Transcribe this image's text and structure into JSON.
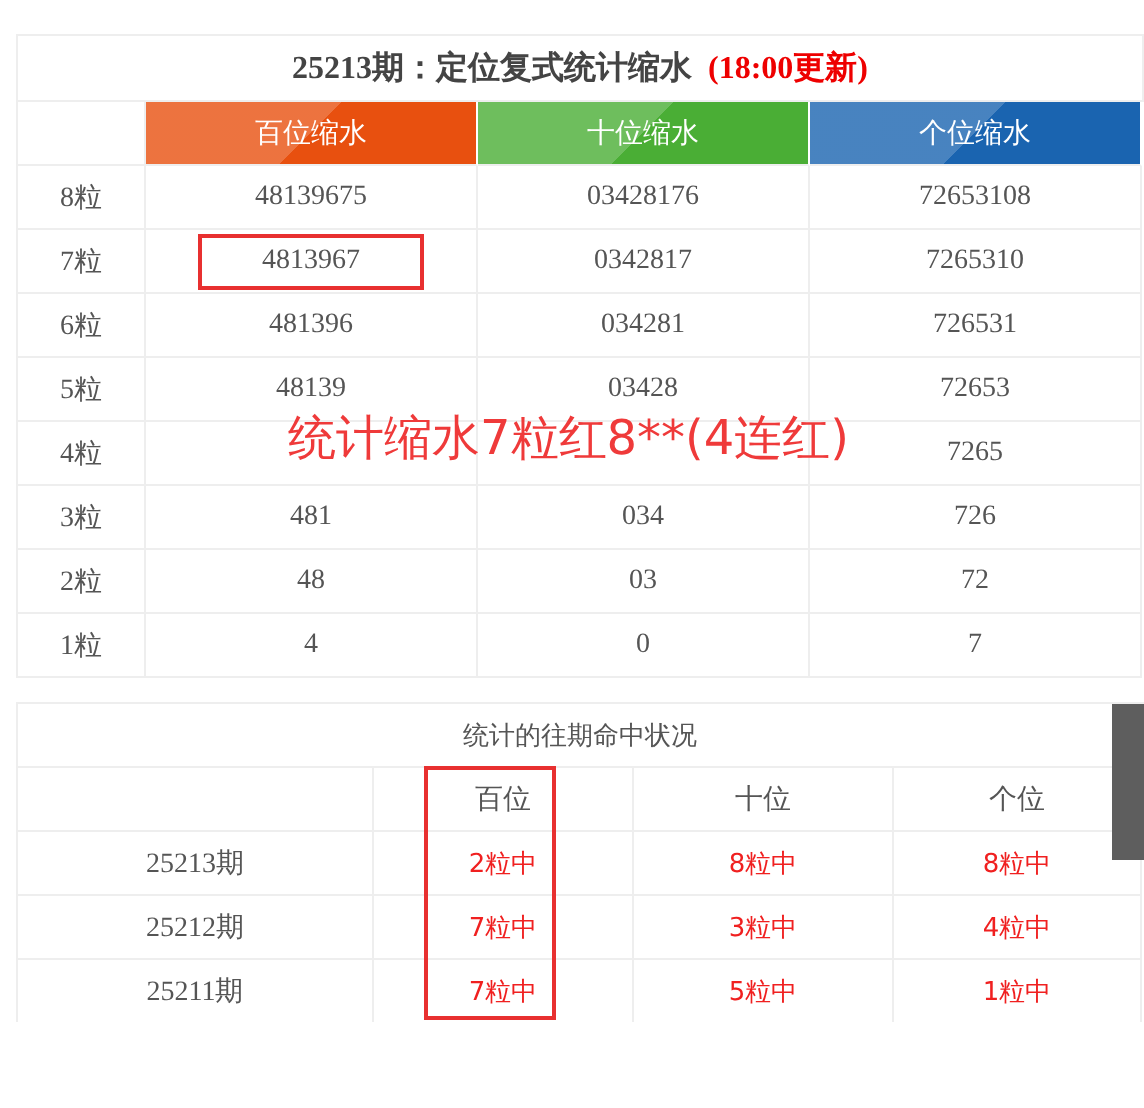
{
  "shrink_table": {
    "title": "25213期：定位复式统计缩水",
    "title_note": "(18:00更新)",
    "columns": [
      {
        "label": "百位缩水",
        "color": "#e8500f"
      },
      {
        "label": "十位缩水",
        "color": "#4aae35"
      },
      {
        "label": "个位缩水",
        "color": "#1a64b0"
      }
    ],
    "rows": [
      {
        "label": "8粒",
        "cells": [
          {
            "text": "48139675",
            "highlighted": false
          },
          {
            "text": "03428176",
            "highlighted": false
          },
          {
            "text": "72653108",
            "highlighted": false
          }
        ]
      },
      {
        "label": "7粒",
        "cells": [
          {
            "text": "4813967",
            "highlighted": true
          },
          {
            "text": "0342817",
            "highlighted": false
          },
          {
            "text": "7265310",
            "highlighted": false
          }
        ]
      },
      {
        "label": "6粒",
        "cells": [
          {
            "text": "481396",
            "highlighted": false
          },
          {
            "text": "034281",
            "highlighted": false
          },
          {
            "text": "726531",
            "highlighted": false
          }
        ]
      },
      {
        "label": "5粒",
        "cells": [
          {
            "text": "48139",
            "highlighted": false
          },
          {
            "text": "03428",
            "highlighted": false
          },
          {
            "text": "72653",
            "highlighted": false
          }
        ]
      },
      {
        "label": "4粒",
        "cells": [
          {
            "highlighted": false
          },
          {
            "highlighted": false
          },
          {
            "text": "7265",
            "highlighted": false
          }
        ]
      },
      {
        "label": "3粒",
        "cells": [
          {
            "text": "481",
            "highlighted": false
          },
          {
            "text": "034",
            "highlighted": false
          },
          {
            "text": "726",
            "highlighted": false
          }
        ]
      },
      {
        "label": "2粒",
        "cells": [
          {
            "text": "48",
            "highlighted": false
          },
          {
            "text": "03",
            "highlighted": false
          },
          {
            "text": "72",
            "highlighted": false
          }
        ]
      },
      {
        "label": "1粒",
        "cells": [
          {
            "text": "4",
            "highlighted": false
          },
          {
            "text": "0",
            "highlighted": false
          },
          {
            "text": "7",
            "highlighted": false
          }
        ]
      }
    ]
  },
  "annotation": "统计缩水7粒红8**(4连红)",
  "history_table": {
    "title": "统计的往期命中状况",
    "columns": [
      {
        "label": "百位",
        "highlighted": true
      },
      {
        "label": "十位",
        "highlighted": false
      },
      {
        "label": "个位",
        "highlighted": false
      }
    ],
    "rows": [
      {
        "period": "25213期",
        "cells": [
          "2粒中",
          "8粒中",
          "8粒中"
        ]
      },
      {
        "period": "25212期",
        "cells": [
          "7粒中",
          "3粒中",
          "4粒中"
        ]
      },
      {
        "period": "25211期",
        "cells": [
          "7粒中",
          "5粒中",
          "1粒中"
        ]
      }
    ]
  }
}
